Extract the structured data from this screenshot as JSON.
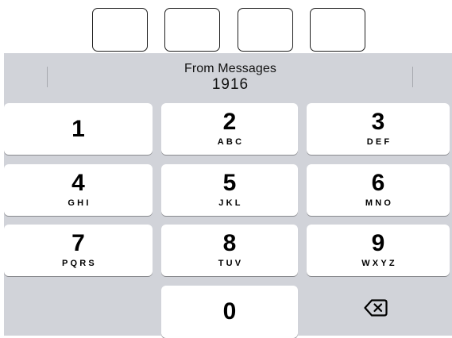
{
  "code_fields": [
    "",
    "",
    "",
    ""
  ],
  "suggestion": {
    "source": "From Messages",
    "code": "1916"
  },
  "keypad": {
    "keys": [
      {
        "digit": "1",
        "letters": ""
      },
      {
        "digit": "2",
        "letters": "ABC"
      },
      {
        "digit": "3",
        "letters": "DEF"
      },
      {
        "digit": "4",
        "letters": "GHI"
      },
      {
        "digit": "5",
        "letters": "JKL"
      },
      {
        "digit": "6",
        "letters": "MNO"
      },
      {
        "digit": "7",
        "letters": "PQRS"
      },
      {
        "digit": "8",
        "letters": "TUV"
      },
      {
        "digit": "9",
        "letters": "WXYZ"
      },
      {
        "digit": "0",
        "letters": ""
      }
    ],
    "delete_icon": "delete-backspace-icon"
  },
  "colors": {
    "keyboard_background": "#d1d3d9",
    "key_background": "#ffffff",
    "key_shadow": "#898a8e",
    "code_box_border": "#1f1f1f"
  }
}
